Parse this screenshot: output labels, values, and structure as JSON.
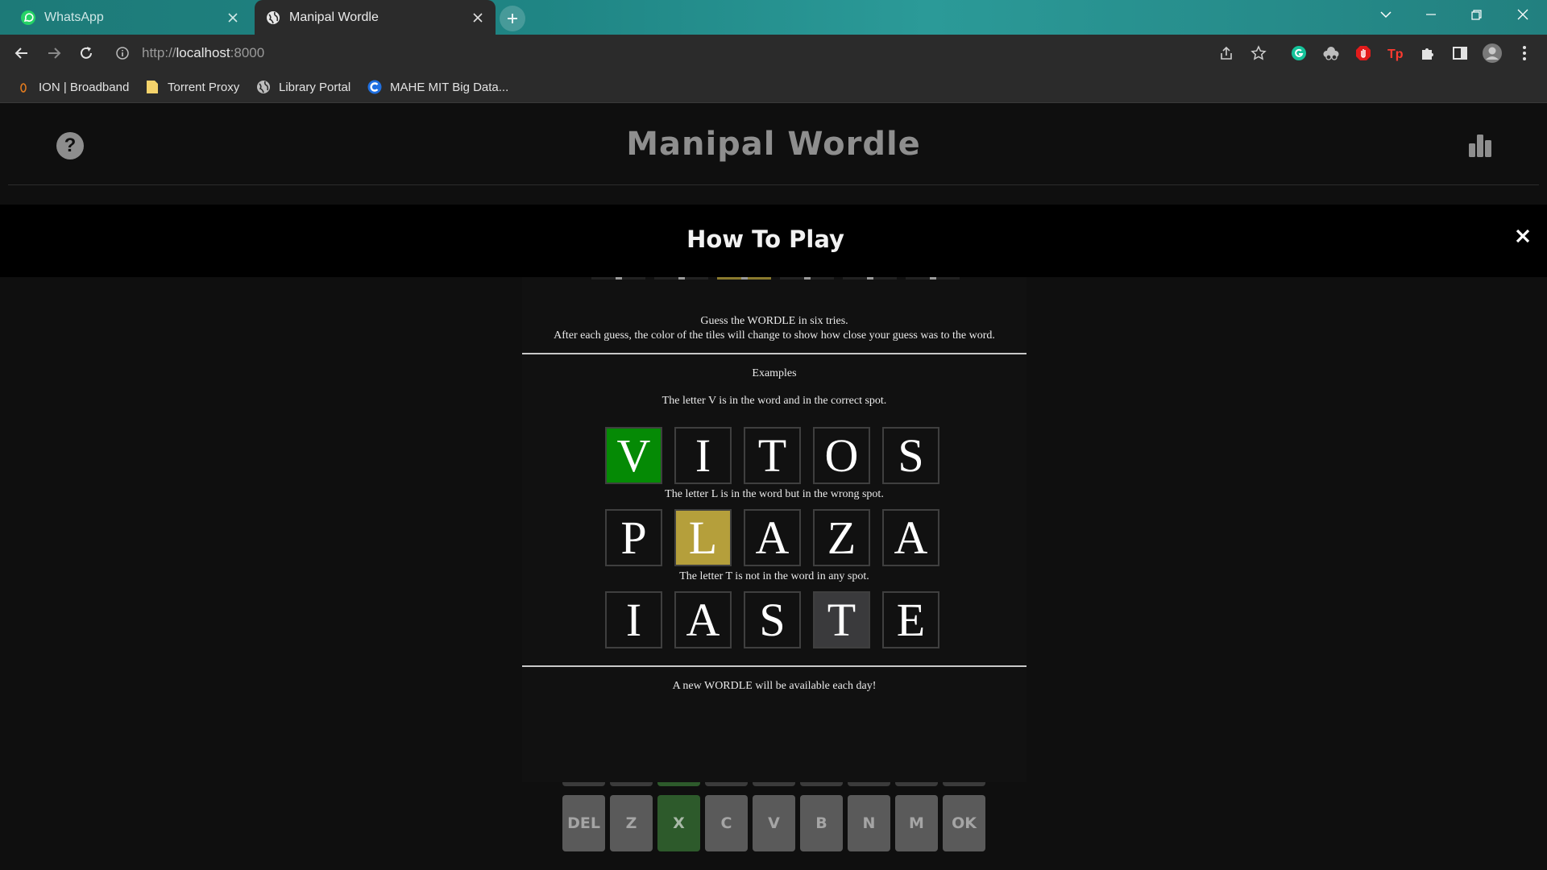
{
  "browser": {
    "tabs": [
      {
        "title": "WhatsApp",
        "active": false,
        "icon": "whatsapp-icon"
      },
      {
        "title": "Manipal Wordle",
        "active": true,
        "icon": "globe-icon"
      }
    ],
    "address": {
      "scheme": "http://",
      "host": "localhost",
      "port": ":8000"
    },
    "bookmarks": [
      {
        "label": "ION | Broadband",
        "icon": "ion-icon"
      },
      {
        "label": "Torrent Proxy",
        "icon": "folder-icon"
      },
      {
        "label": "Library Portal",
        "icon": "globe-icon"
      },
      {
        "label": "MAHE MIT Big Data...",
        "icon": "c-logo-icon"
      }
    ]
  },
  "app": {
    "title": "Manipal Wordle",
    "help_symbol": "?"
  },
  "modal": {
    "title": "How To Play",
    "intro_line1": "Guess the WORDLE in six tries.",
    "intro_line2": "After each guess, the color of the tiles will change to show how close your guess was to the word.",
    "examples_heading": "Examples",
    "examples": [
      {
        "text": "The letter V is in the word and in the correct spot.",
        "letters": [
          "V",
          "I",
          "T",
          "O",
          "S"
        ],
        "highlight_index": 0,
        "state": "correct"
      },
      {
        "text": "The letter L is in the word but in the wrong spot.",
        "letters": [
          "P",
          "L",
          "A",
          "Z",
          "A"
        ],
        "highlight_index": 1,
        "state": "present"
      },
      {
        "text": "The letter T is not in the word in any spot.",
        "letters": [
          "I",
          "A",
          "S",
          "T",
          "E"
        ],
        "highlight_index": 3,
        "state": "absent"
      }
    ],
    "footer": "A new WORDLE will be available each day!"
  },
  "keyboard": {
    "bottom_row": [
      "DEL",
      "Z",
      "X",
      "C",
      "V",
      "B",
      "N",
      "M",
      "OK"
    ],
    "green_keys": [
      "X"
    ]
  },
  "colors": {
    "correct": "#058a05",
    "present": "#b59f3b",
    "absent": "#3a3a3c"
  }
}
